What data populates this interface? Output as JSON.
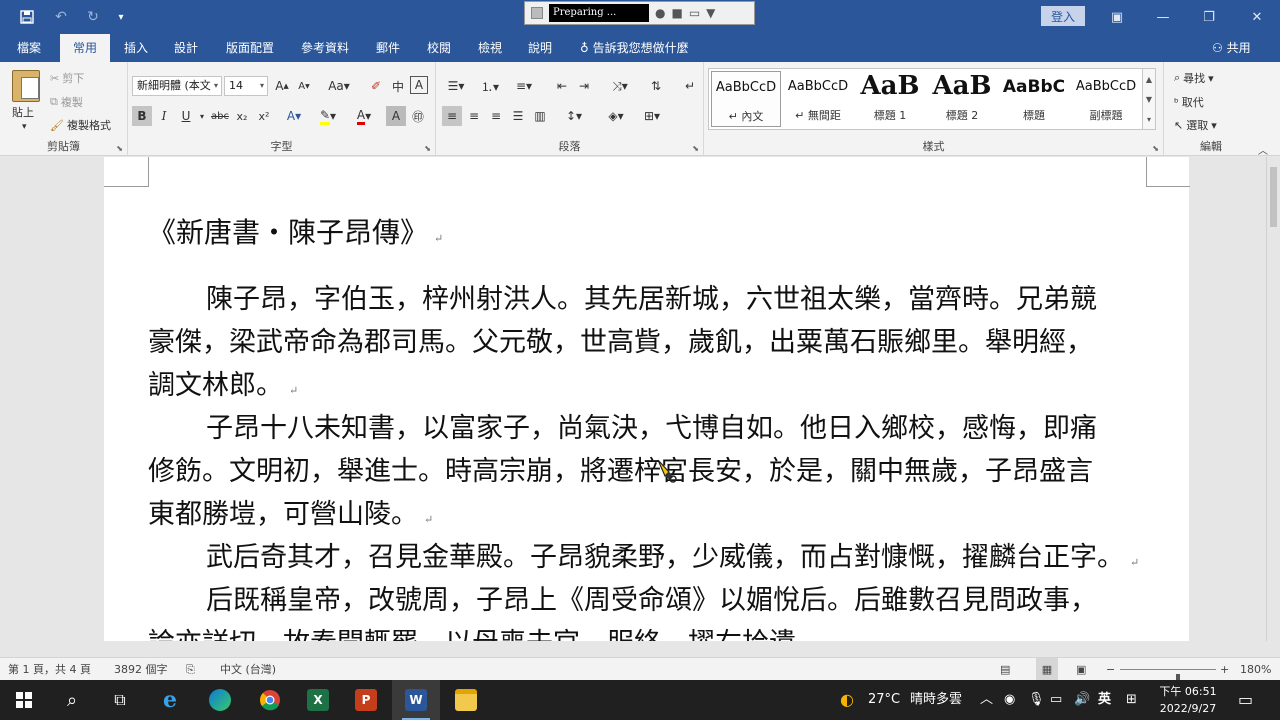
{
  "qat": {
    "save": "save-icon",
    "undo": "undo-icon",
    "redo": "redo-icon"
  },
  "recorder": {
    "status": "Preparing ..."
  },
  "titlebar": {
    "login": "登入"
  },
  "tabs": [
    {
      "label": "檔案"
    },
    {
      "label": "常用"
    },
    {
      "label": "插入"
    },
    {
      "label": "設計"
    },
    {
      "label": "版面配置"
    },
    {
      "label": "參考資料"
    },
    {
      "label": "郵件"
    },
    {
      "label": "校閱"
    },
    {
      "label": "檢視"
    },
    {
      "label": "說明"
    }
  ],
  "tell_me": "告訴我您想做什麼",
  "share": "共用",
  "clipboard": {
    "paste": "貼上",
    "cut": "剪下",
    "copy": "複製",
    "format_painter": "複製格式",
    "label": "剪貼簿"
  },
  "font": {
    "name": "新細明體 (本文",
    "size": "14",
    "label": "字型"
  },
  "paragraph": {
    "label": "段落"
  },
  "styles": {
    "label": "樣式",
    "items": [
      {
        "preview": "AaBbCcD",
        "name": "↵ 內文"
      },
      {
        "preview": "AaBbCcD",
        "name": "↵ 無間距"
      },
      {
        "preview": "AaB",
        "name": "標題 1"
      },
      {
        "preview": "AaB",
        "name": "標題 2"
      },
      {
        "preview": "AaBbC",
        "name": "標題"
      },
      {
        "preview": "AaBbCcD",
        "name": "副標題"
      }
    ]
  },
  "editing": {
    "find": "尋找",
    "replace": "取代",
    "select": "選取",
    "label": "編輯"
  },
  "document": {
    "title": "《新唐書‧陳子昂傳》",
    "lines": [
      "陳子昂，字伯玉，梓州射洪人。其先居新城，六世祖太樂，當齊時。兄弟競",
      "豪傑，梁武帝命為郡司馬。父元敬，世高貲，歲飢，出粟萬石賑鄉里。舉明經，",
      "調文林郎。",
      "子昂十八未知書，以富家子，尚氣決，弋博自如。他日入鄉校，感悔，即痛",
      "修飭。文明初，舉進士。時高宗崩，將遷梓宮長安，於是，關中無歲，子昂盛言",
      "東都勝塏，可營山陵。",
      "武后奇其才，召見金華殿。子昂貌柔野，少威儀，而占對慷慨，擢麟台正字。",
      "后既稱皇帝，改號周，子昂上《周受命頌》以媚悅后。后雖數召見問政事，",
      "論亦詳切，故奏聞輒罷。以母喪去官，服終，擢右拾遺。"
    ]
  },
  "status": {
    "page": "第 1 頁，共 4 頁",
    "words": "3892 個字",
    "language": "中文 (台灣)",
    "zoom": "180%",
    "zoom_fraction": 0.6
  },
  "taskbar": {
    "weather_temp": "27°C",
    "weather_desc": "晴時多雲",
    "ime": "英",
    "time": "下午 06:51",
    "date": "2022/9/27"
  }
}
